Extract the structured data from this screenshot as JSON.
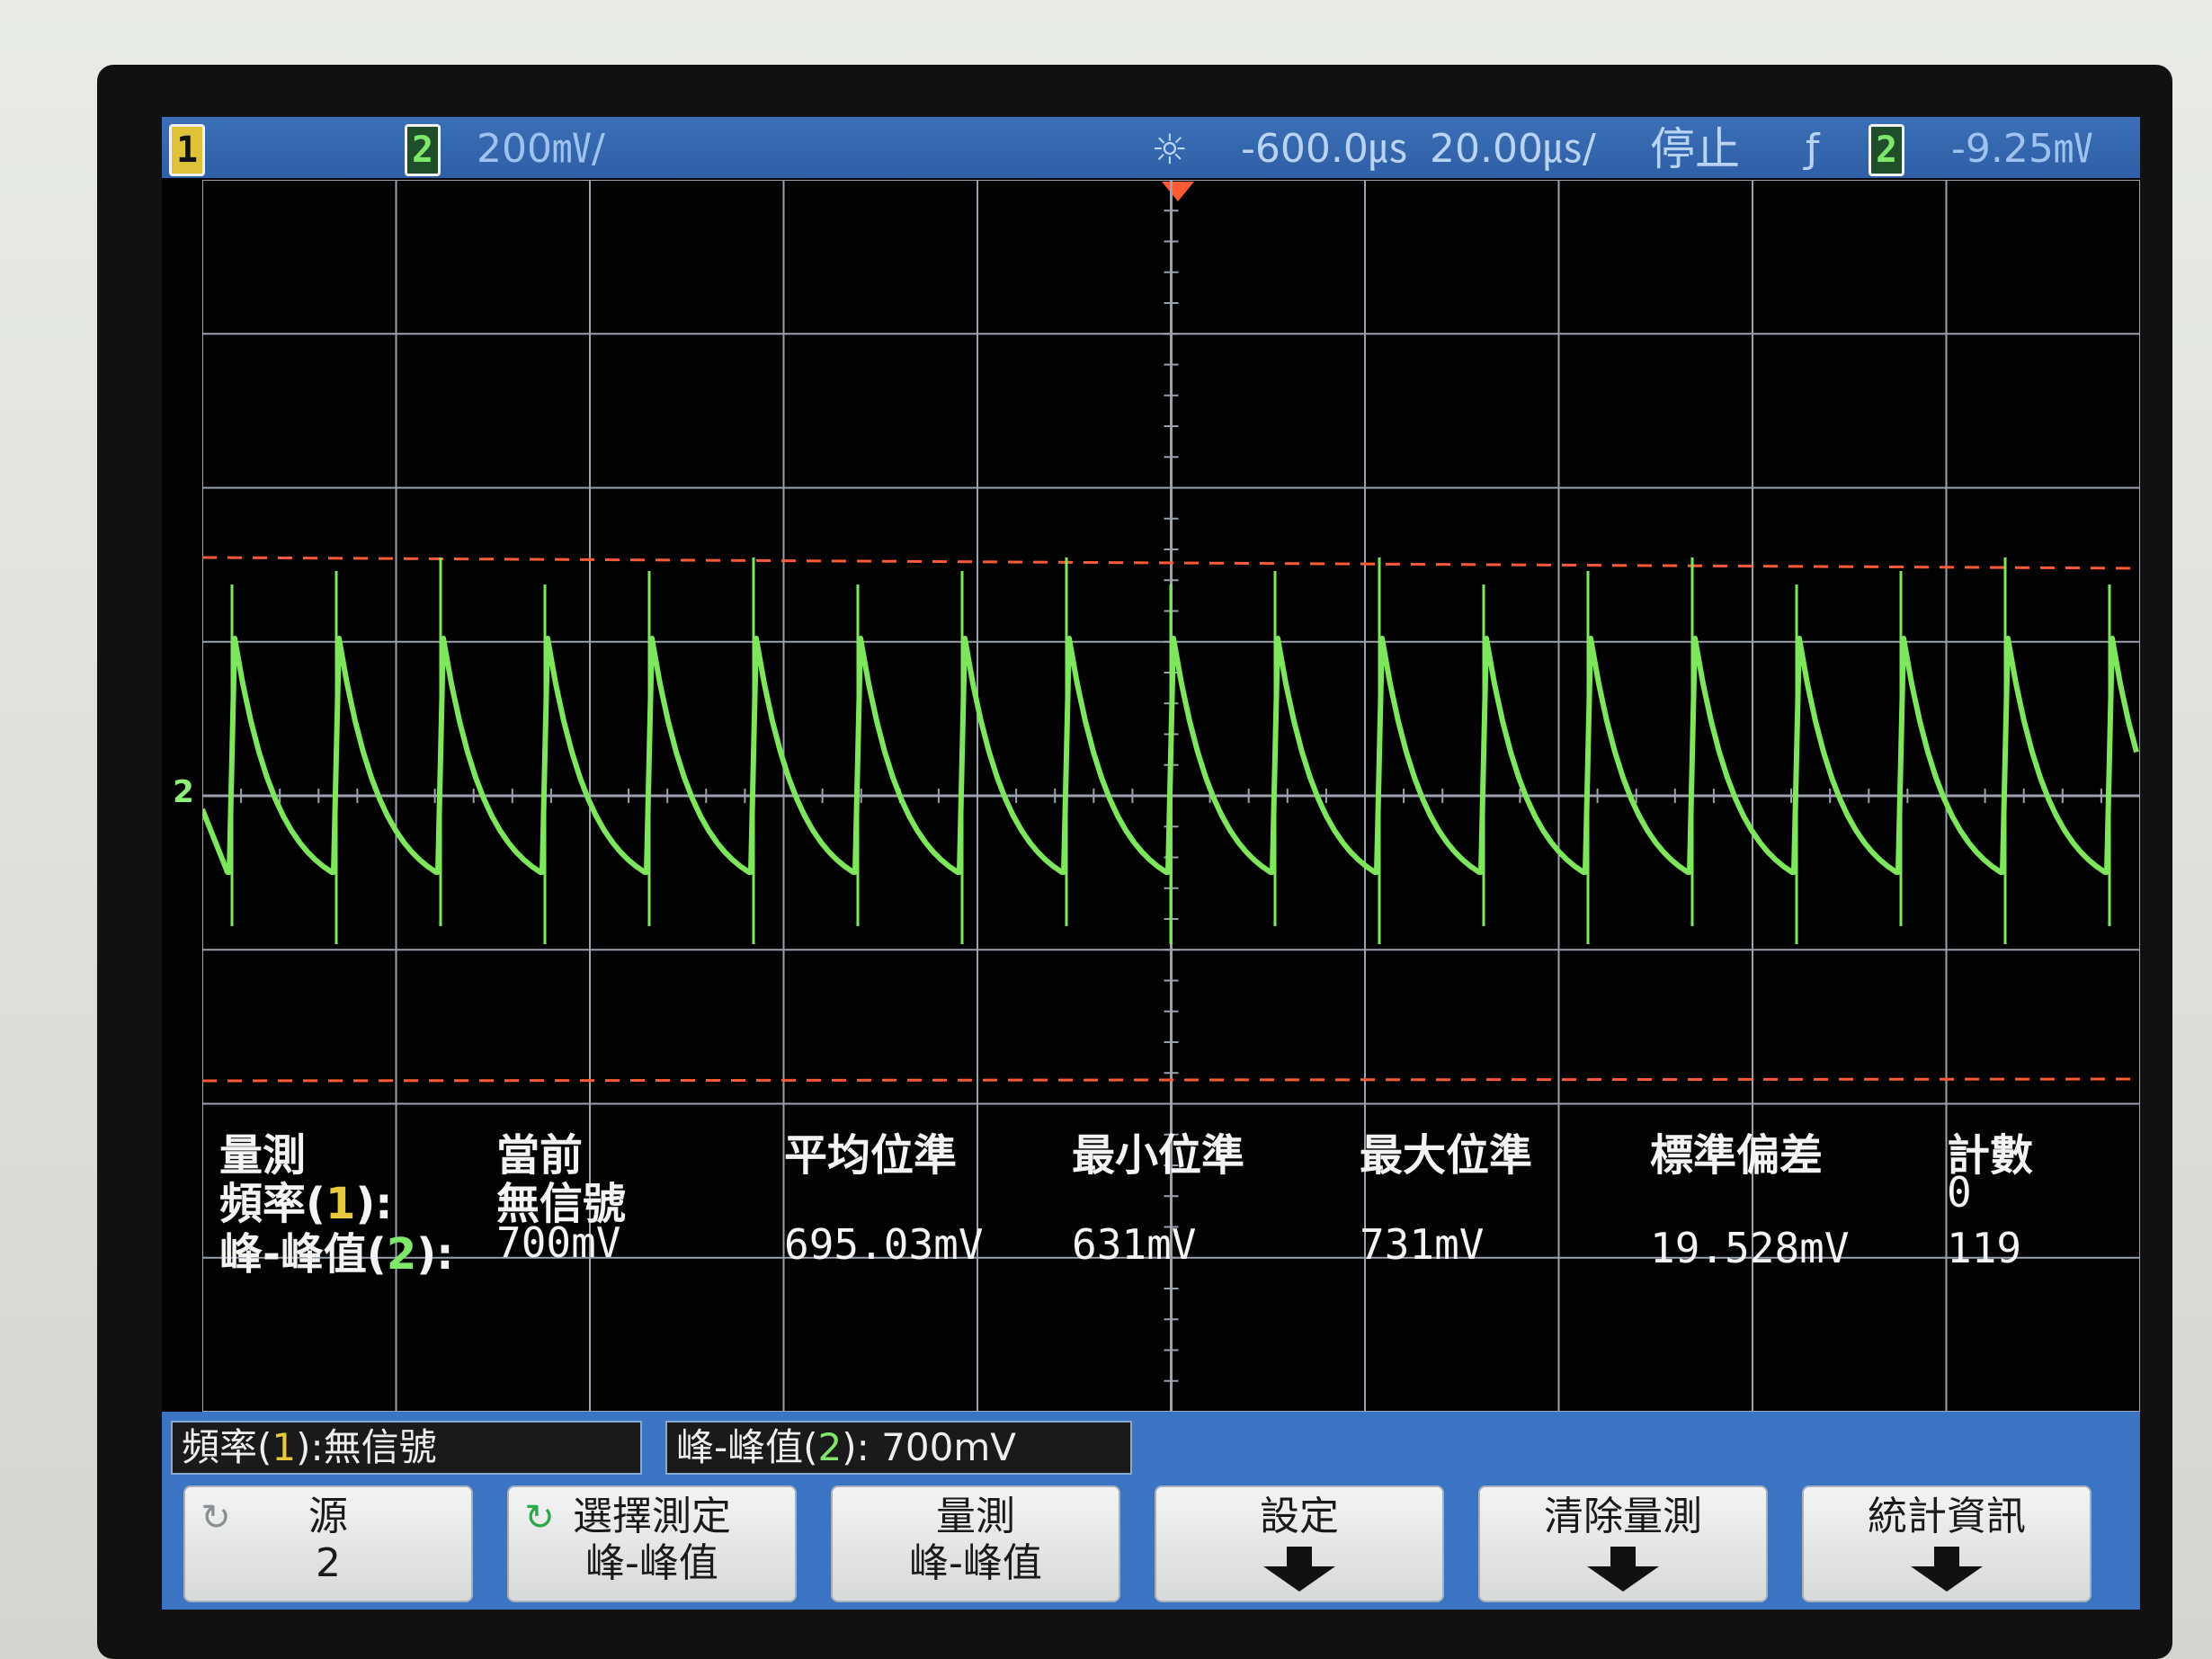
{
  "top_bar": {
    "ch1": "1",
    "ch2": "2",
    "ch2_scale": "200㎷/",
    "acq_icon": "sun-icon",
    "delay": "-600.0㎲",
    "timebase": "20.00㎲/",
    "run_state": "停止",
    "trigger_edge": "ƒ",
    "trigger_source": "2",
    "trigger_level": "-9.25㎷"
  },
  "ground_marker": "2",
  "colors": {
    "ch2_trace": "#7ee65c",
    "grid": "#9aa2ae",
    "cursor": "#ff5a36",
    "top_bar": "#3564ac"
  },
  "measurements": {
    "headers": {
      "name": "量測",
      "current": "當前",
      "mean": "平均位準",
      "min": "最小位準",
      "max": "最大位準",
      "std": "標準偏差",
      "count": "計數"
    },
    "rows": [
      {
        "label": "頻率(",
        "channel": "1",
        "label_end": "):",
        "current": "無信號",
        "mean": "",
        "min": "",
        "max": "",
        "std": "",
        "count": "0"
      },
      {
        "label": "峰-峰值(",
        "channel": "2",
        "label_end": "):",
        "current": "700mV",
        "mean": "695.03mV",
        "min": "631mV",
        "max": "731mV",
        "std": "19.528mV",
        "count": "119"
      }
    ]
  },
  "readouts": {
    "freq_prefix": "頻率(",
    "freq_ch": "1",
    "freq_suffix": "):無信號",
    "pp_prefix": "峰-峰值(",
    "pp_ch": "2",
    "pp_suffix": "): 700mV"
  },
  "softkeys": [
    {
      "line1": "源",
      "line2": "2",
      "icon": "cycle-icon"
    },
    {
      "line1": "選擇測定",
      "line2": "峰-峰值",
      "icon": "cycle-icon"
    },
    {
      "line1": "量測",
      "line2": "峰-峰值"
    },
    {
      "line1": "設定",
      "arrow": "down-arrow-icon"
    },
    {
      "line1": "清除量測",
      "arrow": "down-arrow-icon"
    },
    {
      "line1": "統計資訊",
      "arrow": "down-arrow-icon"
    }
  ]
}
